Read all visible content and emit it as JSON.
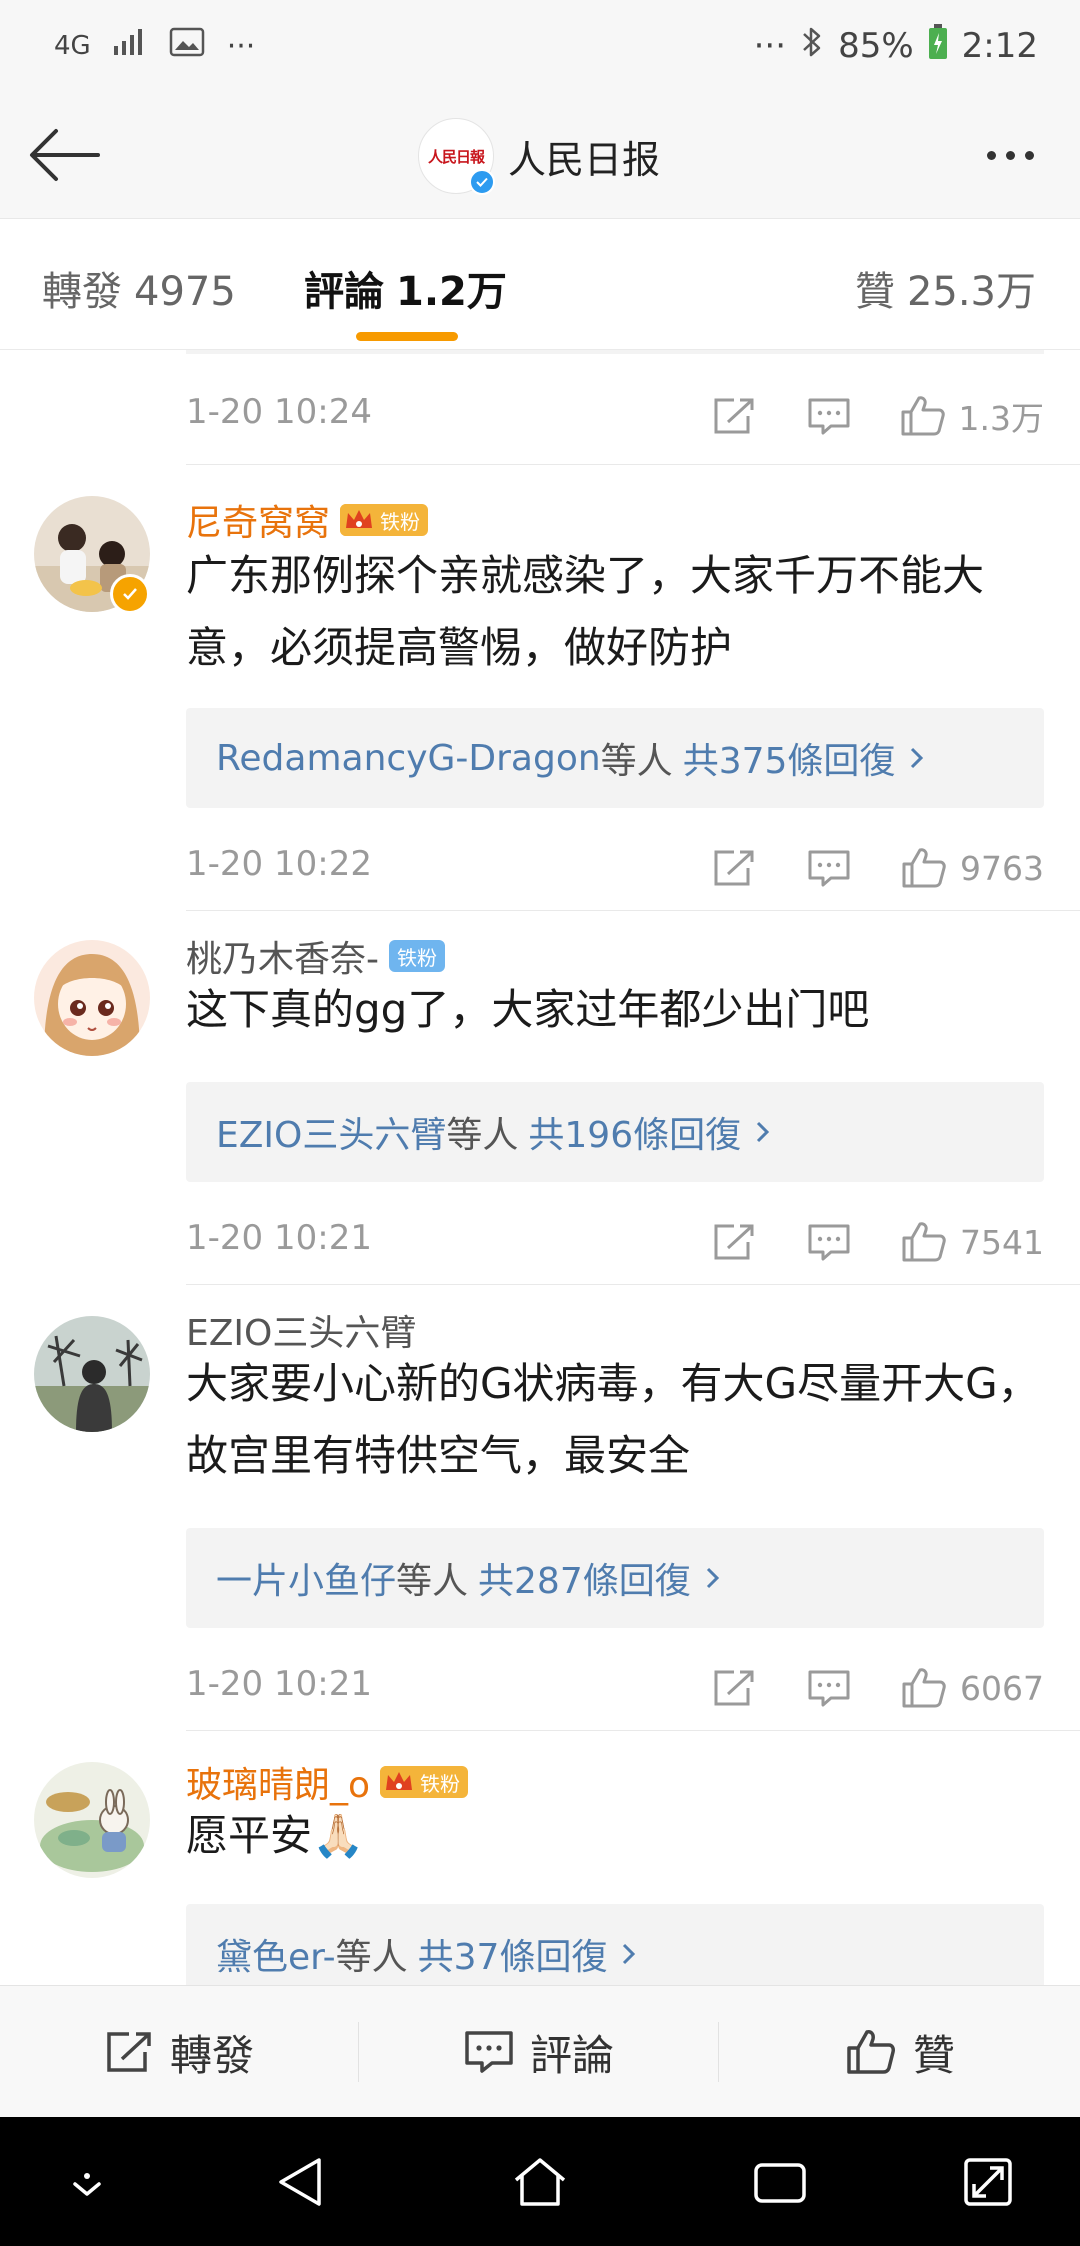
{
  "status_bar": {
    "network": "4G",
    "extra": "···",
    "right_extra": "···",
    "battery": "85%",
    "time": "2:12"
  },
  "header": {
    "title": "人民日报",
    "logo_text": "人民日報"
  },
  "tabs": [
    {
      "label": "轉發",
      "count": "4975"
    },
    {
      "label": "評論",
      "count": "1.2万"
    },
    {
      "label": "贊",
      "count": "25.3万"
    }
  ],
  "top_meta": {
    "time": "1-20 10:24",
    "likes": "1.3万"
  },
  "comments": [
    {
      "user": "尼奇窝窝",
      "badge": "铁粉",
      "text": "广东那例探个亲就感染了，大家千万不能大意，必须提高警惕，做好防护",
      "reply_user": "RedamancyG-Dragon",
      "reply_mid": "等人",
      "reply_count": "共375條回復",
      "time": "1-20 10:22",
      "likes": "9763"
    },
    {
      "user": "桃乃木香奈-",
      "badge": "铁粉",
      "text": "这下真的gg了，大家过年都少出门吧",
      "reply_user": "EZIO三头六臂",
      "reply_mid": "等人",
      "reply_count": "共196條回復",
      "time": "1-20 10:21",
      "likes": "7541"
    },
    {
      "user": "EZIO三头六臂",
      "text": "大家要小心新的G状病毒，有大G尽量开大G，故宫里有特供空气，最安全",
      "reply_user": "一片小鱼仔",
      "reply_mid": "等人",
      "reply_count": "共287條回復",
      "time": "1-20 10:21",
      "likes": "6067"
    },
    {
      "user": "玻璃晴朗_o",
      "badge": "铁粉",
      "text": "愿平安🙏🏻",
      "reply_user": "黛色er-",
      "reply_mid": "等人",
      "reply_count": "共37條回復"
    }
  ],
  "bottom_bar": {
    "repost": "轉發",
    "comment": "評論",
    "like": "贊"
  },
  "colors": {
    "accent": "#f79a00",
    "username_highlight": "#e8730c",
    "link": "#4f7cae"
  }
}
